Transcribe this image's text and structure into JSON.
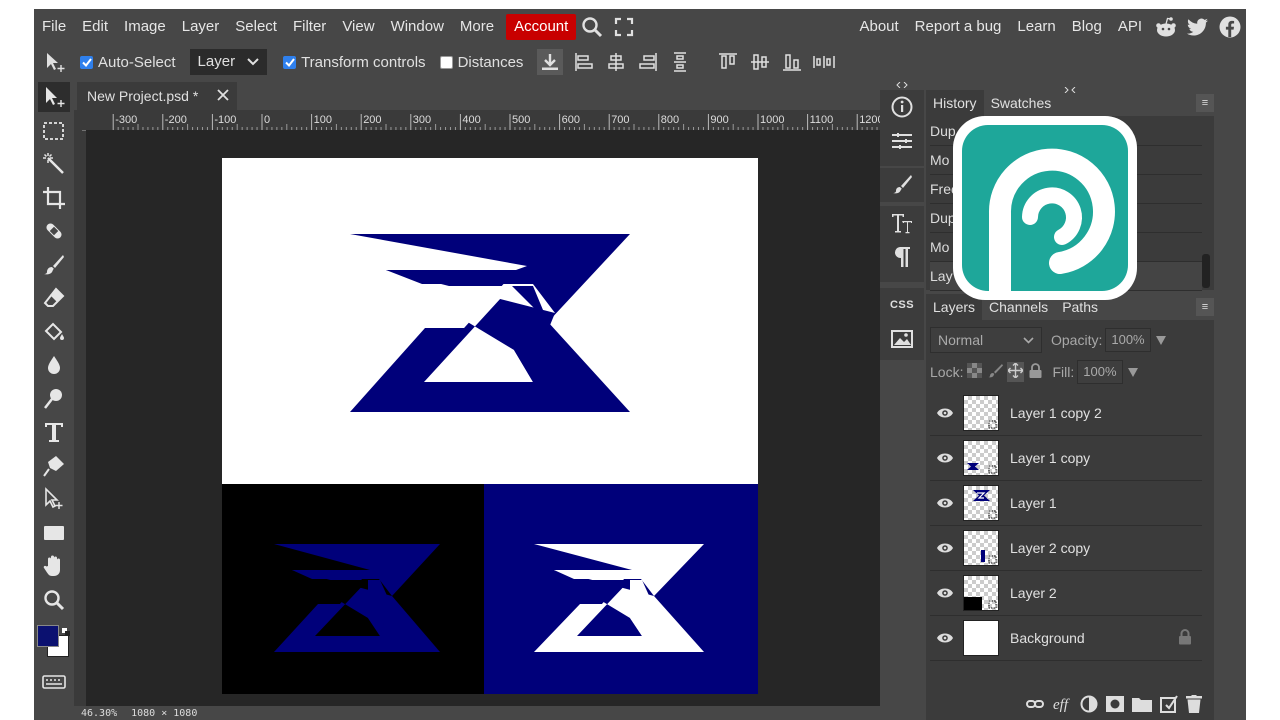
{
  "menu": {
    "items": [
      "File",
      "Edit",
      "Image",
      "Layer",
      "Select",
      "Filter",
      "View",
      "Window",
      "More"
    ],
    "account": "Account",
    "right_links": [
      "About",
      "Report a bug",
      "Learn",
      "Blog",
      "API"
    ]
  },
  "options": {
    "auto_select": "Auto-Select",
    "auto_select_checked": true,
    "select_value": "Layer",
    "transform_controls": "Transform controls",
    "transform_checked": true,
    "distances": "Distances",
    "distances_checked": false
  },
  "document": {
    "tab_title": "New Project.psd *",
    "ruler_labels": [
      "-300",
      "-200",
      "-100",
      "0",
      "100",
      "200",
      "300",
      "400",
      "500",
      "600",
      "700",
      "800",
      "900",
      "1000",
      "1100",
      "1200"
    ],
    "zoom": "46.30%",
    "size": "1080 × 1080"
  },
  "colors": {
    "navy": "#00007a",
    "foreground": "#0b1170",
    "background": "#ffffff",
    "accent_red": "#c80000",
    "logo_teal": "#1ea79a"
  },
  "history": {
    "tabs": [
      "History",
      "Swatches"
    ],
    "items": [
      "Dup",
      "Mo",
      "Free",
      "Dup",
      "Mo",
      "Lay"
    ]
  },
  "layers": {
    "tabs": [
      "Layers",
      "Channels",
      "Paths"
    ],
    "blend_mode": "Normal",
    "opacity_label": "Opacity:",
    "opacity_value": "100%",
    "lock_label": "Lock:",
    "fill_label": "Fill:",
    "fill_value": "100%",
    "rows": [
      {
        "name": "Layer 1 copy 2"
      },
      {
        "name": "Layer 1 copy"
      },
      {
        "name": "Layer 1"
      },
      {
        "name": "Layer 2 copy"
      },
      {
        "name": "Layer 2"
      },
      {
        "name": "Background"
      }
    ]
  },
  "icon_column": {
    "css_label": "CSS"
  }
}
